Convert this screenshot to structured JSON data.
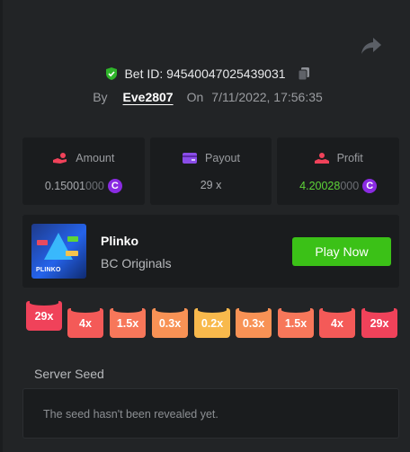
{
  "bet": {
    "id_label": "Bet ID: 94540047025439031",
    "by_label": "By",
    "user": "Eve2807",
    "on_label": "On",
    "datetime": "7/11/2022, 17:56:35"
  },
  "stats": {
    "amount": {
      "label": "Amount",
      "value_main": "0.15001",
      "value_dim": "000",
      "coin": "C"
    },
    "payout": {
      "label": "Payout",
      "value": "29 x"
    },
    "profit": {
      "label": "Profit",
      "value_main": "4.20028",
      "value_dim": "000",
      "coin": "C"
    }
  },
  "game": {
    "title": "Plinko",
    "subtitle": "BC Originals",
    "thumb_label": "PLINKO",
    "play_label": "Play Now"
  },
  "multipliers": [
    {
      "label": "29x",
      "color": "#f0425a",
      "highlighted": true
    },
    {
      "label": "4x",
      "color": "#f45a58",
      "highlighted": false
    },
    {
      "label": "1.5x",
      "color": "#f7775a",
      "highlighted": false
    },
    {
      "label": "0.3x",
      "color": "#f89255",
      "highlighted": false
    },
    {
      "label": "0.2x",
      "color": "#f8b94c",
      "highlighted": false
    },
    {
      "label": "0.3x",
      "color": "#f89255",
      "highlighted": false
    },
    {
      "label": "1.5x",
      "color": "#f7775a",
      "highlighted": false
    },
    {
      "label": "4x",
      "color": "#f45a58",
      "highlighted": false
    },
    {
      "label": "29x",
      "color": "#f0425a",
      "highlighted": false
    }
  ],
  "seed": {
    "label": "Server Seed",
    "text": "The seed hasn't been revealed yet."
  },
  "colors": {
    "accent_green": "#3bc117",
    "profit_green": "#5ed438",
    "coin_purple": "#8a2be2",
    "panel": "#222426",
    "card": "#1a1c1e"
  },
  "icons": {
    "share": "share-arrow-icon",
    "verified": "shield-check-icon",
    "copy": "copy-icon",
    "amount": "hand-coin-icon",
    "payout": "wallet-icon",
    "profit": "profit-icon",
    "coin": "coin-icon"
  }
}
